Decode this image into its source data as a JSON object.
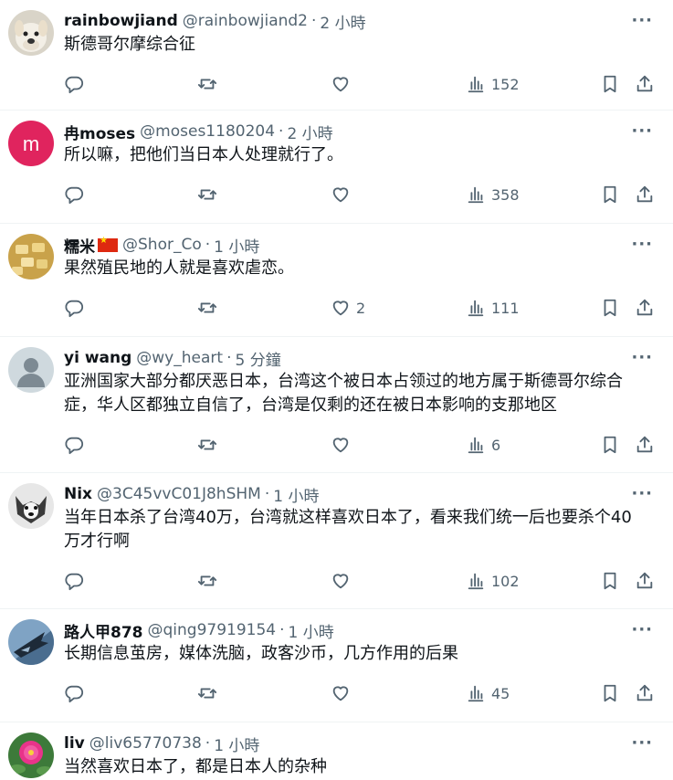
{
  "replies": [
    {
      "name": "rainbowjiand",
      "handle": "@rainbowjiand2",
      "time": "2 小時",
      "text": "斯德哥尔摩综合征",
      "likes": "",
      "views": "152",
      "avatar": "dog"
    },
    {
      "name": "冉moses",
      "handle": "@moses1180204",
      "time": "2 小時",
      "text": "所以嘛，把他们当日本人处理就行了。",
      "likes": "",
      "views": "358",
      "avatar": "letter-m",
      "avatar_letter": "m",
      "avatar_color": "#e0245e"
    },
    {
      "name": "糯米",
      "handle": "@Shor_Co",
      "time": "1 小時",
      "text": "果然殖民地的人就是喜欢虐恋。",
      "likes": "2",
      "views": "111",
      "avatar": "food"
    },
    {
      "name": "yi wang",
      "handle": "@wy_heart",
      "time": "5 分鐘",
      "text": "亚洲国家大部分都厌恶日本，台湾这个被日本占领过的地方属于斯德哥尔综合症，华人区都独立自信了，台湾是仅剩的还在被日本影响的支那地区",
      "likes": "",
      "views": "6",
      "avatar": "default"
    },
    {
      "name": "Nix",
      "handle": "@3C45vvC01J8hSHM",
      "time": "1 小時",
      "text": "当年日本杀了台湾40万，台湾就这样喜欢日本了，看来我们统一后也要杀个40万才行啊",
      "likes": "",
      "views": "102",
      "avatar": "husky"
    },
    {
      "name": "路人甲878",
      "handle": "@qing97919154",
      "time": "1 小時",
      "text": "长期信息茧房，媒体洗脑，政客沙币，几方作用的后果",
      "likes": "",
      "views": "45",
      "avatar": "jet"
    },
    {
      "name": "liv",
      "handle": "@liv65770738",
      "time": "1 小時",
      "text": "当然喜欢日本了，都是日本人的杂种",
      "likes": "",
      "views": "",
      "avatar": "flower"
    }
  ],
  "icons": {
    "more": "more-horizontal-icon",
    "reply": "reply-icon",
    "retweet": "retweet-icon",
    "like": "heart-icon",
    "views": "views-icon",
    "bookmark": "bookmark-icon",
    "share": "share-icon"
  },
  "colors": {
    "text": "#0f1419",
    "secondary": "#536471",
    "divider": "#eff3f4"
  }
}
